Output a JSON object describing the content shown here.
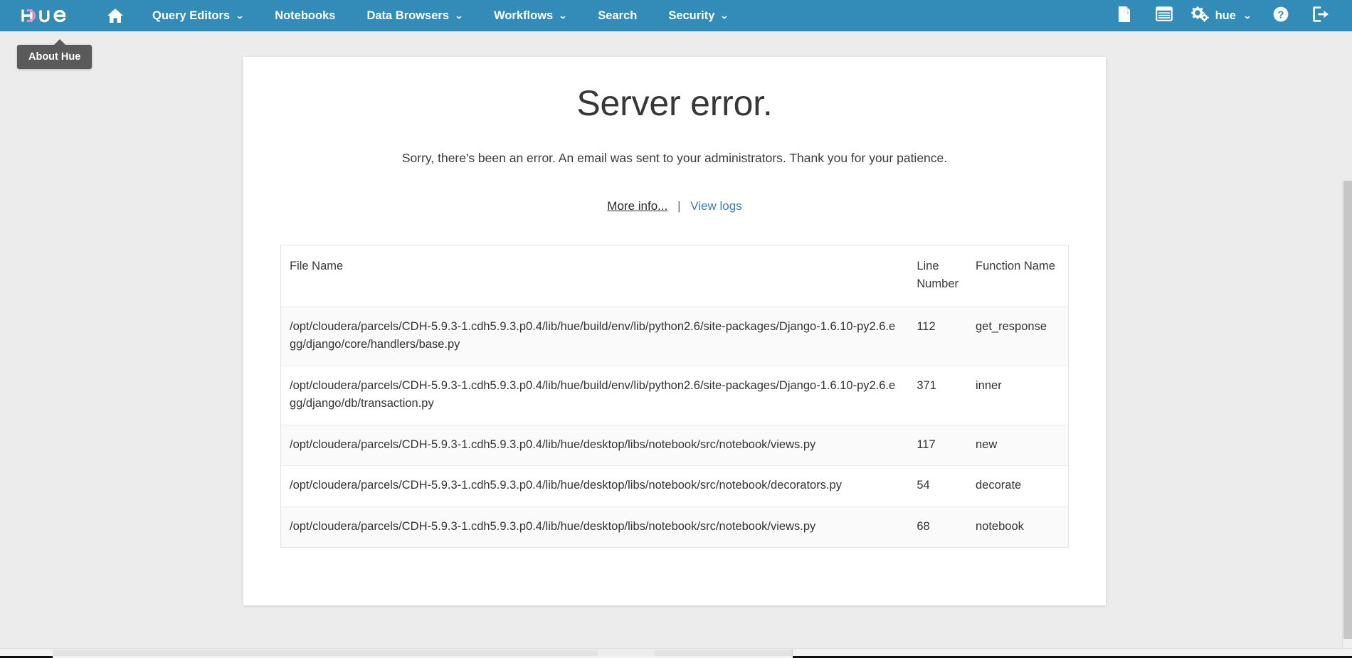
{
  "navbar": {
    "brand_label": "hue",
    "home_label": "Home",
    "items": [
      {
        "label": "Query Editors",
        "has_caret": true
      },
      {
        "label": "Notebooks",
        "has_caret": false
      },
      {
        "label": "Data Browsers",
        "has_caret": true
      },
      {
        "label": "Workflows",
        "has_caret": true
      },
      {
        "label": "Search",
        "has_caret": false
      },
      {
        "label": "Security",
        "has_caret": true
      }
    ],
    "right": {
      "documents_icon": "file-icon",
      "jobs_icon": "list-icon",
      "user_label": "hue",
      "user_icon": "gears-icon",
      "help_icon": "help-circle-icon",
      "logout_icon": "logout-icon",
      "caret": "⌄"
    },
    "caret_glyph": "⌄",
    "accent_color": "#338bb8"
  },
  "tooltip": {
    "label": "About Hue"
  },
  "main": {
    "title": "Server error.",
    "subtitle": "Sorry, there's been an error. An email was sent to your administrators. Thank you for your patience.",
    "links": {
      "more_info": "More info...",
      "separator": "|",
      "view_logs": "View logs",
      "view_logs_color": "#3b7fa8"
    }
  },
  "traceback_table": {
    "columns": [
      "File Name",
      "Line Number",
      "Function Name"
    ],
    "rows": [
      {
        "file_name": "/opt/cloudera/parcels/CDH-5.9.3-1.cdh5.9.3.p0.4/lib/hue/build/env/lib/python2.6/site-packages/Django-1.6.10-py2.6.egg/django/core/handlers/base.py",
        "line_number": "112",
        "function_name": "get_response"
      },
      {
        "file_name": "/opt/cloudera/parcels/CDH-5.9.3-1.cdh5.9.3.p0.4/lib/hue/build/env/lib/python2.6/site-packages/Django-1.6.10-py2.6.egg/django/db/transaction.py",
        "line_number": "371",
        "function_name": "inner"
      },
      {
        "file_name": "/opt/cloudera/parcels/CDH-5.9.3-1.cdh5.9.3.p0.4/lib/hue/desktop/libs/notebook/src/notebook/views.py",
        "line_number": "117",
        "function_name": "new"
      },
      {
        "file_name": "/opt/cloudera/parcels/CDH-5.9.3-1.cdh5.9.3.p0.4/lib/hue/desktop/libs/notebook/src/notebook/decorators.py",
        "line_number": "54",
        "function_name": "decorate"
      },
      {
        "file_name": "/opt/cloudera/parcels/CDH-5.9.3-1.cdh5.9.3.p0.4/lib/hue/desktop/libs/notebook/src/notebook/views.py",
        "line_number": "68",
        "function_name": "notebook"
      }
    ]
  }
}
